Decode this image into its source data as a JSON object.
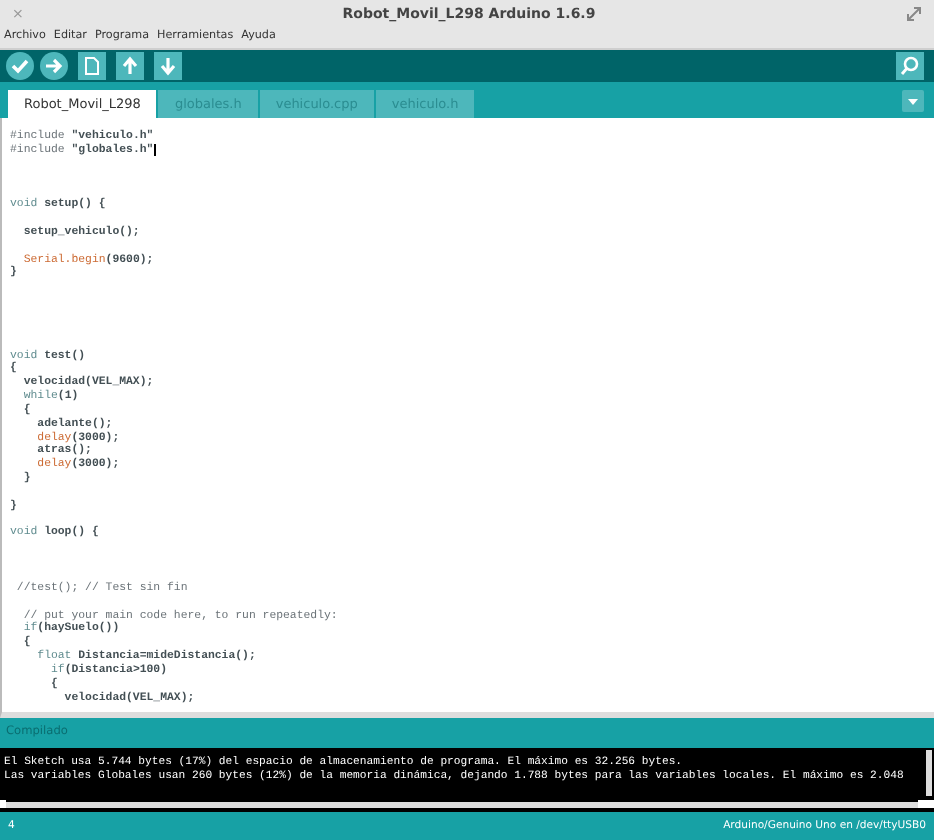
{
  "window": {
    "title": "Robot_Movil_L298 Arduino 1.6.9",
    "close": "×"
  },
  "menu": [
    "Archivo",
    "Editar",
    "Programa",
    "Herramientas",
    "Ayuda"
  ],
  "toolbar": [
    {
      "kind": "verify"
    },
    {
      "kind": "upload"
    },
    {
      "kind": "new"
    },
    {
      "kind": "open"
    },
    {
      "kind": "save"
    }
  ],
  "tabs": [
    {
      "label": "Robot_Movil_L298",
      "selected": true
    },
    {
      "label": "globales.h",
      "selected": false
    },
    {
      "label": "vehiculo.cpp",
      "selected": false
    },
    {
      "label": "vehiculo.h",
      "selected": false
    }
  ],
  "editor": {
    "lines": [
      {
        "kind": "code",
        "parts": [
          {
            "text": "#include",
            "kind": "pre"
          },
          {
            "text": " \"vehiculo.h\"",
            "kind": "plain"
          }
        ]
      },
      {
        "kind": "code",
        "parts": [
          {
            "text": "#include",
            "kind": "pre"
          },
          {
            "text": " \"globales.h\"",
            "kind": "plain"
          }
        ],
        "cursor": true
      },
      {
        "kind": "blank"
      },
      {
        "kind": "blank"
      },
      {
        "kind": "blank"
      },
      {
        "kind": "code",
        "parts": [
          {
            "text": "void",
            "kind": "keyword"
          },
          {
            "text": " setup() {",
            "kind": "plain"
          }
        ]
      },
      {
        "kind": "blank"
      },
      {
        "kind": "code",
        "parts": [
          {
            "text": "  setup_vehiculo();",
            "kind": "plain"
          }
        ]
      },
      {
        "kind": "blank"
      },
      {
        "kind": "code",
        "parts": [
          {
            "text": "  Serial.begin",
            "kind": "function"
          },
          {
            "text": "(9600);",
            "kind": "plain"
          }
        ]
      },
      {
        "kind": "code",
        "parts": [
          {
            "text": "}",
            "kind": "plain"
          }
        ]
      },
      {
        "kind": "blank"
      },
      {
        "kind": "blank"
      },
      {
        "kind": "blank"
      },
      {
        "kind": "blank"
      },
      {
        "kind": "blank"
      },
      {
        "kind": "code",
        "parts": [
          {
            "text": "void",
            "kind": "keyword"
          },
          {
            "text": " test()",
            "kind": "plain"
          }
        ]
      },
      {
        "kind": "code",
        "parts": [
          {
            "text": "{",
            "kind": "plain"
          }
        ]
      },
      {
        "kind": "code",
        "parts": [
          {
            "text": "  velocidad(VEL_MAX);",
            "kind": "plain"
          }
        ]
      },
      {
        "kind": "code",
        "parts": [
          {
            "text": "  while",
            "kind": "keyword"
          },
          {
            "text": "(1)",
            "kind": "plain"
          }
        ]
      },
      {
        "kind": "code",
        "parts": [
          {
            "text": "  {",
            "kind": "plain"
          }
        ]
      },
      {
        "kind": "code",
        "parts": [
          {
            "text": "    adelante();",
            "kind": "plain"
          }
        ]
      },
      {
        "kind": "code",
        "parts": [
          {
            "text": "    delay",
            "kind": "function"
          },
          {
            "text": "(3000);",
            "kind": "plain"
          }
        ]
      },
      {
        "kind": "code",
        "parts": [
          {
            "text": "    atras();",
            "kind": "plain"
          }
        ]
      },
      {
        "kind": "code",
        "parts": [
          {
            "text": "    delay",
            "kind": "function"
          },
          {
            "text": "(3000);",
            "kind": "plain"
          }
        ]
      },
      {
        "kind": "code",
        "parts": [
          {
            "text": "  }",
            "kind": "plain"
          }
        ]
      },
      {
        "kind": "blank"
      },
      {
        "kind": "code",
        "parts": [
          {
            "text": "}",
            "kind": "plain"
          }
        ]
      },
      {
        "kind": "blank"
      },
      {
        "kind": "code",
        "parts": [
          {
            "text": "void",
            "kind": "keyword"
          },
          {
            "text": " loop() {",
            "kind": "plain"
          }
        ]
      },
      {
        "kind": "blank"
      },
      {
        "kind": "blank"
      },
      {
        "kind": "blank"
      },
      {
        "kind": "code",
        "parts": [
          {
            "text": " //test(); // Test sin fin",
            "kind": "comment"
          }
        ]
      },
      {
        "kind": "blank"
      },
      {
        "kind": "code",
        "parts": [
          {
            "text": "  // put your main code here, to run repeatedly:",
            "kind": "comment"
          }
        ]
      },
      {
        "kind": "code",
        "parts": [
          {
            "text": "  if",
            "kind": "keyword"
          },
          {
            "text": "(haySuelo())",
            "kind": "plain"
          }
        ]
      },
      {
        "kind": "code",
        "parts": [
          {
            "text": "  {",
            "kind": "plain"
          }
        ]
      },
      {
        "kind": "code",
        "parts": [
          {
            "text": "    float",
            "kind": "keyword"
          },
          {
            "text": " Distancia=mideDistancia();",
            "kind": "plain"
          }
        ]
      },
      {
        "kind": "code",
        "parts": [
          {
            "text": "      if",
            "kind": "keyword"
          },
          {
            "text": "(Distancia>100)",
            "kind": "plain"
          }
        ]
      },
      {
        "kind": "code",
        "parts": [
          {
            "text": "      {",
            "kind": "plain"
          }
        ]
      },
      {
        "kind": "code",
        "parts": [
          {
            "text": "        velocidad(VEL_MAX);",
            "kind": "plain"
          }
        ]
      }
    ]
  },
  "console": {
    "title": "Compilado",
    "lines": [
      "El Sketch usa 5.744 bytes (17%) del espacio de almacenamiento de programa. El máximo es 32.256 bytes.",
      "Las variables Globales usan 260 bytes (12%) de la memoria dinámica, dejando 1.788 bytes para las variables locales. El máximo es 2.048"
    ]
  },
  "status_bar": {
    "line": "4",
    "board": "Arduino/Genuino Uno en /dev/ttyUSB0"
  }
}
